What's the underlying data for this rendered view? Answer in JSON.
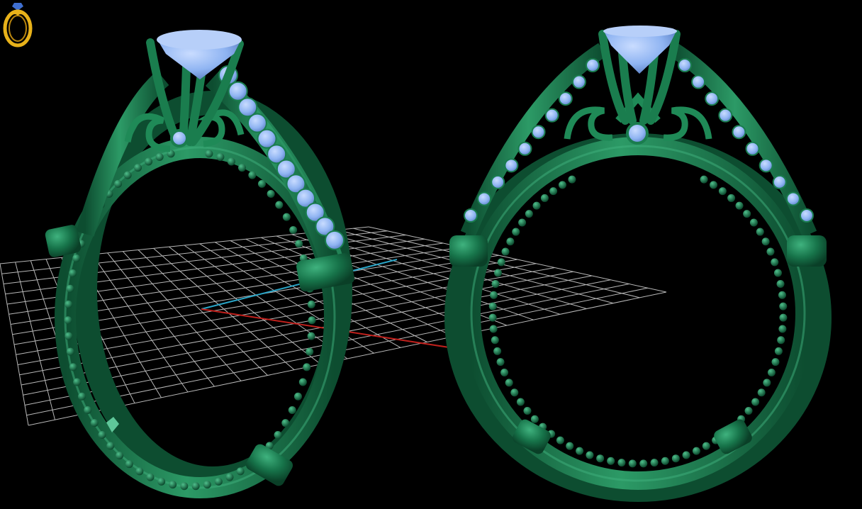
{
  "viewport": {
    "background": "#000000",
    "grid_color": "#d8d8d8",
    "axis_x_color": "#c0201c",
    "axis_y_color": "#2aa6c8"
  },
  "material": {
    "metal_color": "#17744a",
    "metal_highlight": "#3fb27e",
    "metal_shadow": "#0a3f27",
    "stone_color": "#8fb4f2",
    "stone_shadow": "#5a7fc4"
  },
  "models": [
    {
      "name": "ring-model-perspective",
      "view": "perspective"
    },
    {
      "name": "ring-model-front",
      "view": "front"
    }
  ],
  "logo": {
    "icon": "ring-logo-icon",
    "ring_color": "#e8b21a",
    "gem_color": "#3f6fd0"
  }
}
